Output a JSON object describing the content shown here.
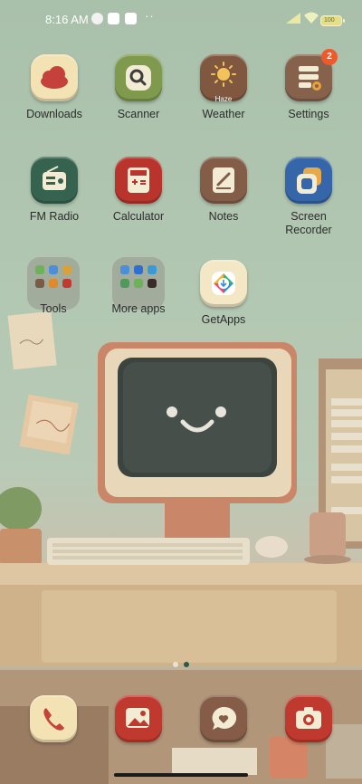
{
  "status_bar": {
    "time": "8:16 AM",
    "battery_label": "100"
  },
  "colors": {
    "label_text": "#2c2c2c",
    "badge": "#ef5a2a",
    "status_text": "#ffffff"
  },
  "grid": {
    "downloads": {
      "label": "Downloads",
      "icon": "cloud-icon"
    },
    "scanner": {
      "label": "Scanner",
      "icon": "magnifier-icon"
    },
    "weather": {
      "label": "Weather",
      "icon": "sun-icon",
      "sub": "Haze"
    },
    "settings": {
      "label": "Settings",
      "icon": "settings-list-icon",
      "badge": "2"
    },
    "fm_radio": {
      "label": "FM Radio",
      "icon": "radio-icon"
    },
    "calculator": {
      "label": "Calculator",
      "icon": "calculator-icon"
    },
    "notes": {
      "label": "Notes",
      "icon": "pencil-note-icon"
    },
    "screen_recorder": {
      "label": "Screen\nRecorder",
      "icon": "screen-recorder-icon"
    },
    "tools": {
      "label": "Tools",
      "icon": "folder-icon"
    },
    "more_apps": {
      "label": "More apps",
      "icon": "folder-icon"
    },
    "getapps": {
      "label": "GetApps",
      "icon": "getapps-icon"
    }
  },
  "dock": {
    "phone": {
      "icon": "phone-icon"
    },
    "gallery": {
      "icon": "gallery-icon"
    },
    "messages": {
      "icon": "message-heart-icon"
    },
    "camera": {
      "icon": "camera-icon"
    }
  },
  "pagination": {
    "pages": 2,
    "active": 2
  }
}
